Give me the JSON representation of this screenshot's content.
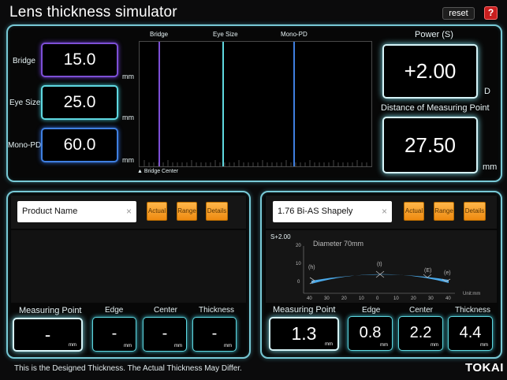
{
  "app": {
    "title": "Lens thickness simulator",
    "reset_label": "reset",
    "help_label": "?"
  },
  "top": {
    "bridge": {
      "label": "Bridge",
      "value": "15.0",
      "unit": "mm",
      "color": "#7d4fd6"
    },
    "eye_size": {
      "label": "Eye Size",
      "value": "25.0",
      "unit": "mm",
      "color": "#5fd8e0"
    },
    "mono_pd": {
      "label": "Mono-PD",
      "value": "60.0",
      "unit": "mm",
      "color": "#3f7fe0"
    },
    "diagram": {
      "bridge_label": "Bridge",
      "eye_label": "Eye Size",
      "pd_label": "Mono-PD",
      "center_label": "▲ Bridge Center"
    },
    "power": {
      "label": "Power (S)",
      "value": "+2.00",
      "unit": "D"
    },
    "measuring_distance": {
      "label": "Distance of Measuring Point",
      "value": "27.50",
      "unit": "mm"
    }
  },
  "left_panel": {
    "product_field": "Product Name",
    "clear_icon": "×",
    "buttons": {
      "actual": "Actual",
      "range": "Range",
      "details": "Details"
    },
    "measuring_point": {
      "label": "Measuring Point",
      "value": "-",
      "unit": "mm"
    },
    "edge": {
      "label": "Edge",
      "value": "-",
      "unit": "mm"
    },
    "center": {
      "label": "Center",
      "value": "-",
      "unit": "mm"
    },
    "thickness": {
      "label": "Thickness",
      "value": "-",
      "unit": "mm"
    }
  },
  "right_panel": {
    "product_field": "1.76 Bi-AS Shapely",
    "clear_icon": "×",
    "buttons": {
      "actual": "Actual",
      "range": "Range",
      "details": "Details"
    },
    "profile": {
      "power_label": "S+2.00",
      "diameter_label": "Diameter 70mm",
      "y_ticks": [
        "20",
        "10",
        "0"
      ],
      "x_ticks": [
        "40",
        "30",
        "20",
        "10",
        "0",
        "10",
        "20",
        "30",
        "40"
      ],
      "unit_label": "Unit:mm",
      "markers": [
        "(h)",
        "(t)",
        "(E)",
        "(e)"
      ],
      "lens_color": "#4aa8e8"
    },
    "measuring_point": {
      "label": "Measuring Point",
      "value": "1.3",
      "unit": "mm"
    },
    "edge": {
      "label": "Edge",
      "value": "0.8",
      "unit": "mm"
    },
    "center": {
      "label": "Center",
      "value": "2.2",
      "unit": "mm"
    },
    "thickness": {
      "label": "Thickness",
      "value": "4.4",
      "unit": "mm"
    }
  },
  "footer": {
    "disclaimer": "This is the Designed Thickness.  The Actual Thickness May Differ.",
    "brand": "TOKAI"
  }
}
